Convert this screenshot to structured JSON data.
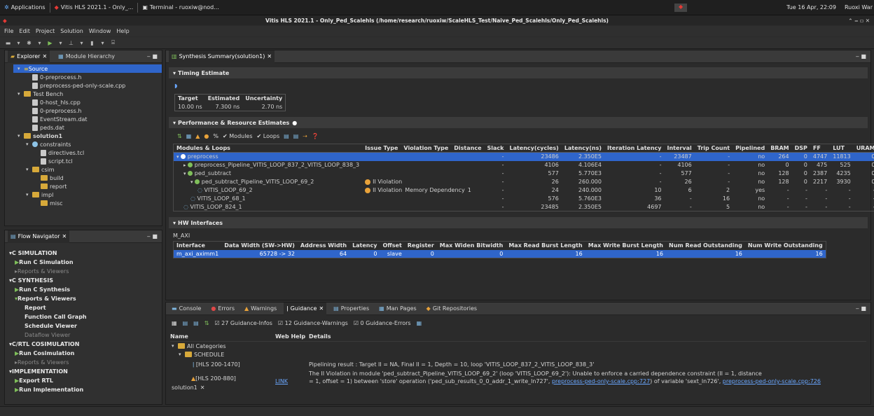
{
  "taskbar": {
    "apps_label": "Applications",
    "task1": "Vitis HLS 2021.1 - Only_...",
    "task2": "Terminal - ruoxiw@nod...",
    "clock": "Tue 16 Apr, 22:09",
    "user": "Ruoxi War"
  },
  "window_title": "Vitis HLS 2021.1 - Only_Ped_Scalehls (/home/research/ruoxiw/ScaleHLS_Test/Naive_Ped_Scalehls/Only_Ped_Scalehls)",
  "menu": [
    "File",
    "Edit",
    "Project",
    "Solution",
    "Window",
    "Help"
  ],
  "explorer": {
    "tabs": [
      "Explorer",
      "Module Hierarchy"
    ],
    "items": [
      {
        "label": "Source",
        "level": 0,
        "icon": "folder-src-icon",
        "selected": true
      },
      {
        "label": "0-preprocess.h",
        "level": 1,
        "icon": "file-icon"
      },
      {
        "label": "preprocess-ped-only-scale.cpp",
        "level": 1,
        "icon": "file-icon"
      },
      {
        "label": "Test Bench",
        "level": 0,
        "icon": "folder-icon"
      },
      {
        "label": "0-host_hls.cpp",
        "level": 1,
        "icon": "file-icon"
      },
      {
        "label": "0-preprocess.h",
        "level": 1,
        "icon": "file-icon"
      },
      {
        "label": "EventStream.dat",
        "level": 1,
        "icon": "file-icon"
      },
      {
        "label": "peds.dat",
        "level": 1,
        "icon": "file-icon"
      },
      {
        "label": "solution1",
        "level": 0,
        "icon": "folder-icon",
        "bold": true
      },
      {
        "label": "constraints",
        "level": 1,
        "icon": "gear-icon"
      },
      {
        "label": "directives.tcl",
        "level": 2,
        "icon": "file-icon"
      },
      {
        "label": "script.tcl",
        "level": 2,
        "icon": "file-icon"
      },
      {
        "label": "csim",
        "level": 1,
        "icon": "folder-icon"
      },
      {
        "label": "build",
        "level": 2,
        "icon": "folder-icon"
      },
      {
        "label": "report",
        "level": 2,
        "icon": "folder-icon"
      },
      {
        "label": "impl",
        "level": 1,
        "icon": "folder-icon"
      },
      {
        "label": "misc",
        "level": 2,
        "icon": "folder-icon"
      }
    ]
  },
  "flow": {
    "title": "Flow Navigator",
    "items": [
      {
        "label": "C SIMULATION",
        "kind": "h"
      },
      {
        "label": "Run C Simulation",
        "kind": "i"
      },
      {
        "label": "Reports & Viewers",
        "kind": "i",
        "dim": true
      },
      {
        "label": "C SYNTHESIS",
        "kind": "h"
      },
      {
        "label": "Run C Synthesis",
        "kind": "i"
      },
      {
        "label": "Reports & Viewers",
        "kind": "i"
      },
      {
        "label": "Report",
        "kind": "j"
      },
      {
        "label": "Function Call Graph",
        "kind": "j"
      },
      {
        "label": "Schedule Viewer",
        "kind": "j"
      },
      {
        "label": "Dataflow Viewer",
        "kind": "j",
        "dim": true
      },
      {
        "label": "C/RTL COSIMULATION",
        "kind": "h"
      },
      {
        "label": "Run Cosimulation",
        "kind": "i"
      },
      {
        "label": "Reports & Viewers",
        "kind": "i",
        "dim": true
      },
      {
        "label": "IMPLEMENTATION",
        "kind": "h"
      },
      {
        "label": "Export RTL",
        "kind": "i"
      },
      {
        "label": "Run Implementation",
        "kind": "i"
      }
    ]
  },
  "editor_tab": "Synthesis Summary(solution1)",
  "timing": {
    "section": "Timing Estimate",
    "headers": [
      "Target",
      "Estimated",
      "Uncertainty"
    ],
    "values": [
      "10.00 ns",
      "7.300 ns",
      "2.70 ns"
    ]
  },
  "perf": {
    "section": "Performance & Resource Estimates",
    "modules_label": "Modules",
    "loops_label": "Loops",
    "headers": [
      "Modules & Loops",
      "Issue Type",
      "Violation Type",
      "Distance",
      "Slack",
      "Latency(cycles)",
      "Latency(ns)",
      "Iteration Latency",
      "Interval",
      "Trip Count",
      "Pipelined",
      "BRAM",
      "DSP",
      "FF",
      "LUT",
      "URAM"
    ],
    "rows": [
      {
        "indent": 0,
        "name": "preprocess",
        "issue": "",
        "vtype": "",
        "dist": "",
        "slack": "-",
        "lat_c": "23486",
        "lat_ns": "2.350E5",
        "iter": "-",
        "interval": "23487",
        "trip": "-",
        "pipe": "no",
        "bram": "264",
        "dsp": "0",
        "ff": "4747",
        "lut": "11813",
        "uram": "0",
        "sel": true
      },
      {
        "indent": 1,
        "name": "preprocess_Pipeline_VITIS_LOOP_837_2_VITIS_LOOP_838_3",
        "issue": "",
        "vtype": "",
        "dist": "",
        "slack": "-",
        "lat_c": "4106",
        "lat_ns": "4.106E4",
        "iter": "-",
        "interval": "4106",
        "trip": "-",
        "pipe": "no",
        "bram": "0",
        "dsp": "0",
        "ff": "475",
        "lut": "525",
        "uram": "0"
      },
      {
        "indent": 1,
        "name": "ped_subtract",
        "issue": "",
        "vtype": "",
        "dist": "",
        "slack": "-",
        "lat_c": "577",
        "lat_ns": "5.770E3",
        "iter": "-",
        "interval": "577",
        "trip": "-",
        "pipe": "no",
        "bram": "128",
        "dsp": "0",
        "ff": "2387",
        "lut": "4235",
        "uram": "0"
      },
      {
        "indent": 2,
        "name": "ped_subtract_Pipeline_VITIS_LOOP_69_2",
        "issue": "II Violation",
        "vtype": "",
        "dist": "",
        "slack": "-",
        "lat_c": "26",
        "lat_ns": "260.000",
        "iter": "-",
        "interval": "26",
        "trip": "-",
        "pipe": "no",
        "bram": "128",
        "dsp": "0",
        "ff": "2217",
        "lut": "3930",
        "uram": "0",
        "redint": true
      },
      {
        "indent": 3,
        "name": "VITIS_LOOP_69_2",
        "issue": "II Violation",
        "vtype": "Memory Dependency",
        "dist": "1",
        "slack": "-",
        "lat_c": "24",
        "lat_ns": "240.000",
        "iter": "10",
        "interval": "6",
        "trip": "2",
        "pipe": "yes",
        "bram": "-",
        "dsp": "-",
        "ff": "-",
        "lut": "-",
        "uram": "-",
        "loop": true,
        "redint": true
      },
      {
        "indent": 2,
        "name": "VITIS_LOOP_68_1",
        "issue": "",
        "vtype": "",
        "dist": "",
        "slack": "-",
        "lat_c": "576",
        "lat_ns": "5.760E3",
        "iter": "36",
        "interval": "-",
        "trip": "16",
        "pipe": "no",
        "bram": "-",
        "dsp": "-",
        "ff": "-",
        "lut": "-",
        "uram": "-",
        "loop": true
      },
      {
        "indent": 1,
        "name": "VITIS_LOOP_824_1",
        "issue": "",
        "vtype": "",
        "dist": "",
        "slack": "-",
        "lat_c": "23485",
        "lat_ns": "2.350E5",
        "iter": "4697",
        "interval": "-",
        "trip": "5",
        "pipe": "no",
        "bram": "-",
        "dsp": "-",
        "ff": "-",
        "lut": "-",
        "uram": "-",
        "loop": true
      }
    ]
  },
  "hw": {
    "section": "HW Interfaces",
    "group": "M_AXI",
    "headers": [
      "Interface",
      "Data Width (SW->HW)",
      "Address Width",
      "Latency",
      "Offset",
      "Register",
      "Max Widen Bitwidth",
      "Max Read Burst Length",
      "Max Write Burst Length",
      "Num Read Outstanding",
      "Num Write Outstanding"
    ],
    "row": [
      "m_axi_aximm1",
      "65728 -> 32",
      "64",
      "0",
      "slave",
      "0",
      "0",
      "16",
      "16",
      "16",
      "16"
    ]
  },
  "bottom": {
    "tabs": [
      "Console",
      "Errors",
      "Warnings",
      "Guidance",
      "Properties",
      "Man Pages",
      "Git Repositories"
    ],
    "filters": [
      "27 Guidance-Infos",
      "12 Guidance-Warnings",
      "0 Guidance-Errors"
    ],
    "headers": [
      "Name",
      "Web Help",
      "Details"
    ],
    "tree": [
      "All Categories",
      "SCHEDULE",
      "[HLS 200-1470]",
      "[HLS 200-880]"
    ],
    "webhelp": "LINK",
    "detail1": "Pipelining result : Target II = NA, Final II = 1, Depth = 10, loop 'VITIS_LOOP_837_2_VITIS_LOOP_838_3'",
    "detail2a": "The II Violation in module 'ped_subtract_Pipeline_VITIS_LOOP_69_2' (loop 'VITIS_LOOP_69_2'): Unable to enforce a carried dependence constraint (II = 1, distance",
    "detail2b": "= 1, offset = 1) between 'store' operation ('ped_sub_results_0_0_addr_1_write_ln727', ",
    "link1": "preprocess-ped-only-scale.cpp:727",
    "detail2c": ") of variable 'sext_ln726', ",
    "link2": "preprocess-ped-only-scale.cpp:726",
    "solution_tab": "solution1"
  }
}
